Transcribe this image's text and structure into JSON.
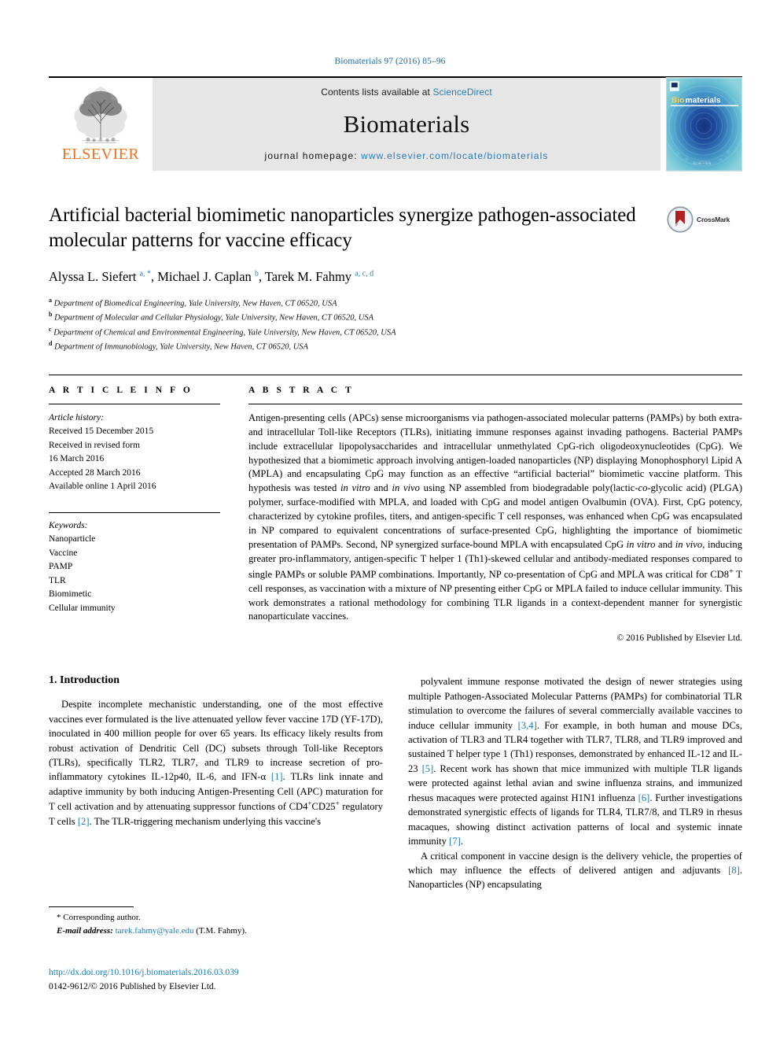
{
  "running_head": "Biomaterials 97 (2016) 85–96",
  "masthead": {
    "publisher_name": "ELSEVIER",
    "contents_prefix": "Contents lists available at ",
    "sciencedirect": "ScienceDirect",
    "journal_title": "Biomaterials",
    "homepage_prefix": "journal homepage: ",
    "homepage_url": "www.elsevier.com/locate/biomaterials",
    "cover_title_a": "Bio",
    "cover_title_b": "materials",
    "cover_footer": "Elsevier"
  },
  "article": {
    "title": "Artificial bacterial biomimetic nanoparticles synergize pathogen-associated molecular patterns for vaccine efficacy",
    "crossmark_label": "CrossMark",
    "authors_html": "Alyssa L. Siefert <sup>a, *</sup>, Michael J. Caplan <sup>b</sup>, Tarek M. Fahmy <sup>a, c, d</sup>",
    "affiliations": [
      {
        "marker": "a",
        "text": "Department of Biomedical Engineering, Yale University, New Haven, CT 06520, USA"
      },
      {
        "marker": "b",
        "text": "Department of Molecular and Cellular Physiology, Yale University, New Haven, CT 06520, USA"
      },
      {
        "marker": "c",
        "text": "Department of Chemical and Environmental Engineering, Yale University, New Haven, CT 06520, USA"
      },
      {
        "marker": "d",
        "text": "Department of Immunobiology, Yale University, New Haven, CT 06520, USA"
      }
    ]
  },
  "article_info": {
    "heading": "A R T I C L E   I N F O",
    "history_label": "Article history:",
    "history": [
      "Received 15 December 2015",
      "Received in revised form",
      "16 March 2016",
      "Accepted 28 March 2016",
      "Available online 1 April 2016"
    ],
    "keywords_label": "Keywords:",
    "keywords": [
      "Nanoparticle",
      "Vaccine",
      "PAMP",
      "TLR",
      "Biomimetic",
      "Cellular immunity"
    ]
  },
  "abstract": {
    "heading": "A B S T R A C T",
    "text_html": "Antigen-presenting cells (APCs) sense microorganisms via pathogen-associated molecular patterns (PAMPs) by both extra- and intracellular Toll-like Receptors (TLRs), initiating immune responses against invading pathogens. Bacterial PAMPs include extracellular lipopolysaccharides and intracellular unmethylated CpG-rich oligodeoxynucleotides (CpG). We hypothesized that a biomimetic approach involving antigen-loaded nanoparticles (NP) displaying Monophosphoryl Lipid A (MPLA) and encapsulating CpG may function as an effective &ldquo;artificial bacterial&rdquo; biomimetic vaccine platform. This hypothesis was tested <i>in vitro</i> and <i>in vivo</i> using NP assembled from biodegradable poly(lactic-<i>co</i>-glycolic acid) (PLGA) polymer, surface-modified with MPLA, and loaded with CpG and model antigen Ovalbumin (OVA). First, CpG potency, characterized by cytokine profiles, titers, and antigen-specific T cell responses, was enhanced when CpG was encapsulated in NP compared to equivalent concentrations of surface-presented CpG, highlighting the importance of biomimetic presentation of PAMPs. Second, NP synergized surface-bound MPLA with encapsulated CpG <i>in vitro</i> and <i>in vivo</i>, inducing greater pro-inflammatory, antigen-specific T helper 1 (Th1)-skewed cellular and antibody-mediated responses compared to single PAMPs or soluble PAMP combinations. Importantly, NP co-presentation of CpG and MPLA was critical for CD8<sup>+</sup> T cell responses, as vaccination with a mixture of NP presenting either CpG or MPLA failed to induce cellular immunity. This work demonstrates a rational methodology for combining TLR ligands in a context-dependent manner for synergistic nanoparticulate vaccines.",
    "copyright": "© 2016 Published by Elsevier Ltd."
  },
  "body": {
    "section_heading": "1. Introduction",
    "left_paragraphs_html": [
      "Despite incomplete mechanistic understanding, one of the most effective vaccines ever formulated is the live attenuated yellow fever vaccine 17D (YF-17D), inoculated in 400 million people for over 65 years. Its efficacy likely results from robust activation of Dendritic Cell (DC) subsets through Toll-like Receptors (TLRs), specifically TLR2, TLR7, and TLR9 to increase secretion of pro-inflammatory cytokines IL-12p40, IL-6, and IFN-&alpha; <span class=\"ref\">[1]</span>. TLRs link innate and adaptive immunity by both inducing Antigen-Presenting Cell (APC) maturation for T cell activation and by attenuating suppressor functions of CD4<sup class=\"plus\">+</sup>CD25<sup class=\"plus\">+</sup> regulatory T cells <span class=\"ref\">[2]</span>. The TLR-triggering mechanism underlying this vaccine's"
    ],
    "right_paragraphs_html": [
      "polyvalent immune response motivated the design of newer strategies using multiple Pathogen-Associated Molecular Patterns (PAMPs) for combinatorial TLR stimulation to overcome the failures of several commercially available vaccines to induce cellular immunity <span class=\"ref\">[3,4]</span>. For example, in both human and mouse DCs, activation of TLR3 and TLR4 together with TLR7, TLR8, and TLR9 improved and sustained T helper type 1 (Th1) responses, demonstrated by enhanced IL-12 and IL-23 <span class=\"ref\">[5]</span>. Recent work has shown that mice immunized with multiple TLR ligands were protected against lethal avian and swine influenza strains, and immunized rhesus macaques were protected against H1N1 influenza <span class=\"ref\">[6]</span>. Further investigations demonstrated synergistic effects of ligands for TLR4, TLR7/8, and TLR9 in rhesus macaques, showing distinct activation patterns of local and systemic innate immunity <span class=\"ref\">[7]</span>.",
      "A critical component in vaccine design is the delivery vehicle, the properties of which may influence the effects of delivered antigen and adjuvants <span class=\"ref\">[8]</span>. Nanoparticles (NP) encapsulating"
    ]
  },
  "footnote": {
    "star": "*",
    "corresponding": "Corresponding author.",
    "email_label": "E-mail address:",
    "email": "tarek.fahmy@yale.edu",
    "email_suffix": "(T.M. Fahmy)."
  },
  "imprint": {
    "doi": "http://dx.doi.org/10.1016/j.biomaterials.2016.03.039",
    "issn_line": "0142-9612/© 2016 Published by Elsevier Ltd."
  },
  "colors": {
    "link": "#1a7bb9",
    "elsevier_orange": "#f06f1e",
    "band_grey": "#e6e6e6",
    "cover_blue": "#1f4e9c"
  }
}
